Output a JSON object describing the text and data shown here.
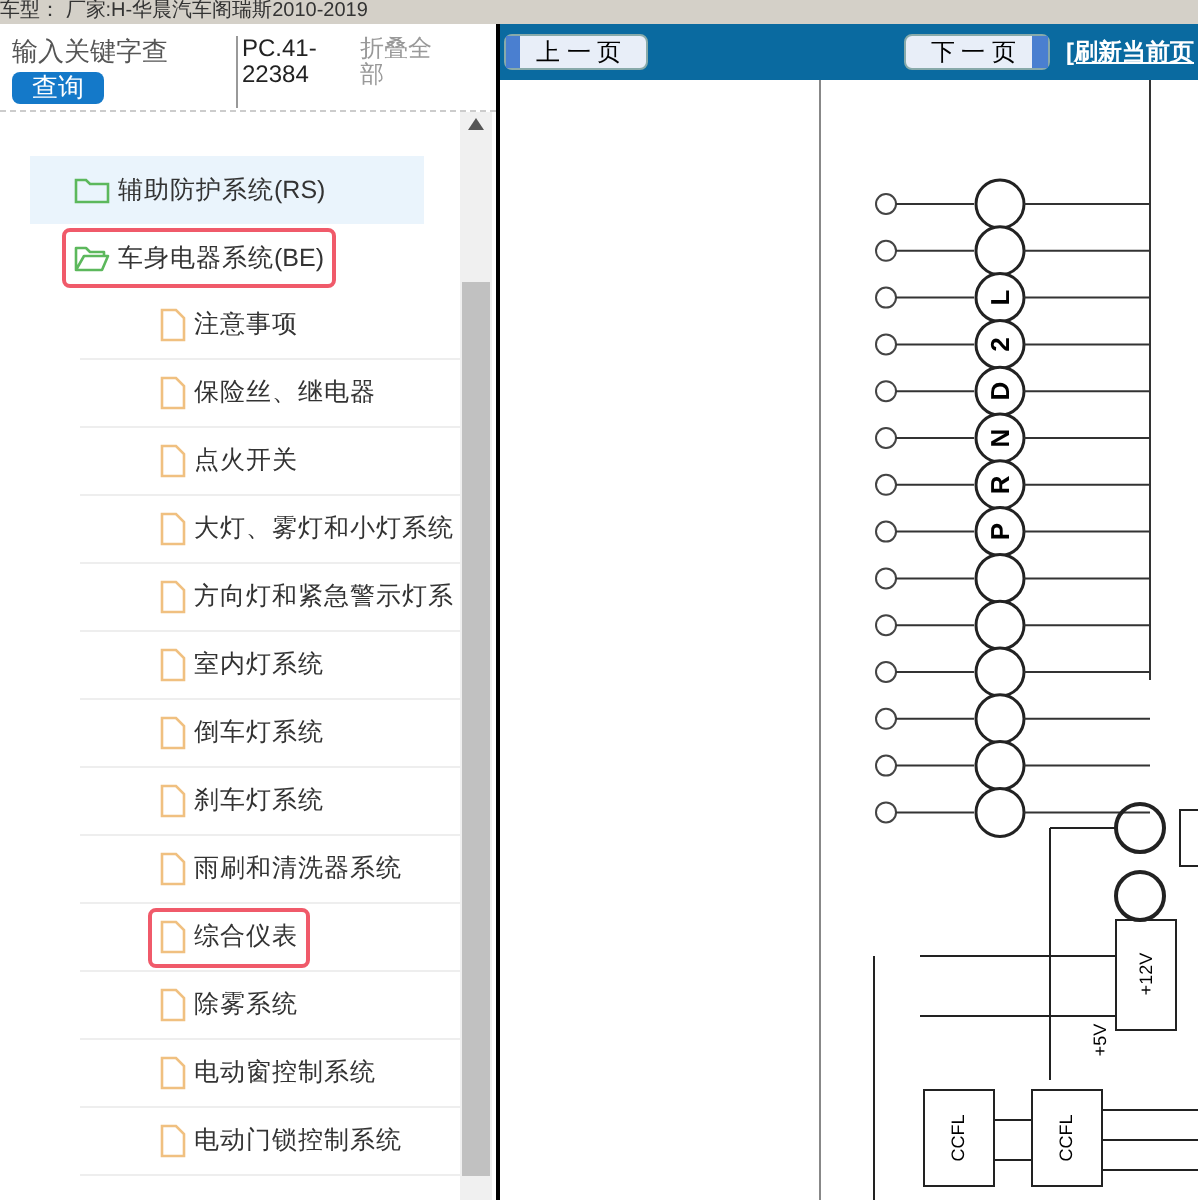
{
  "title_bar": {
    "text": "车型： 厂家:H-华晨汽车阁瑞斯2010-2019"
  },
  "sidebar": {
    "search_label": "输入关键字查",
    "search_button": "查询",
    "code": "PC.41-22384",
    "collapse_all": "折叠全部",
    "tree": [
      {
        "label": "辅助防护系统(RS)",
        "kind": "folder",
        "selected": true,
        "highlighted": false,
        "expanded": false
      },
      {
        "label": "车身电器系统(BE)",
        "kind": "folder",
        "selected": false,
        "highlighted": true,
        "expanded": true,
        "children": [
          {
            "label": "注意事项",
            "kind": "page",
            "selected": false,
            "highlighted": false
          },
          {
            "label": "保险丝、继电器",
            "kind": "page",
            "selected": false,
            "highlighted": false
          },
          {
            "label": "点火开关",
            "kind": "page",
            "selected": false,
            "highlighted": false
          },
          {
            "label": "大灯、雾灯和小灯系统",
            "kind": "page",
            "selected": false,
            "highlighted": false
          },
          {
            "label": "方向灯和紧急警示灯系",
            "kind": "page",
            "selected": false,
            "highlighted": false
          },
          {
            "label": "室内灯系统",
            "kind": "page",
            "selected": false,
            "highlighted": false
          },
          {
            "label": "倒车灯系统",
            "kind": "page",
            "selected": false,
            "highlighted": false
          },
          {
            "label": "刹车灯系统",
            "kind": "page",
            "selected": false,
            "highlighted": false
          },
          {
            "label": "雨刷和清洗器系统",
            "kind": "page",
            "selected": false,
            "highlighted": false
          },
          {
            "label": "综合仪表",
            "kind": "page",
            "selected": false,
            "highlighted": true
          },
          {
            "label": "除雾系统",
            "kind": "page",
            "selected": false,
            "highlighted": false
          },
          {
            "label": "电动窗控制系统",
            "kind": "page",
            "selected": false,
            "highlighted": false
          },
          {
            "label": "电动门锁控制系统",
            "kind": "page",
            "selected": false,
            "highlighted": false
          }
        ]
      }
    ]
  },
  "viewer": {
    "prev_button": "上 一 页",
    "next_button": "下 一 页",
    "refresh_link": "[刷新当前页",
    "diagram": {
      "gear_labels": [
        "L",
        "2",
        "D",
        "N",
        "R",
        "P"
      ],
      "voltage_labels": [
        "+12V",
        "+5V"
      ],
      "module_labels": [
        "CCFL",
        "CCFL"
      ]
    }
  }
}
